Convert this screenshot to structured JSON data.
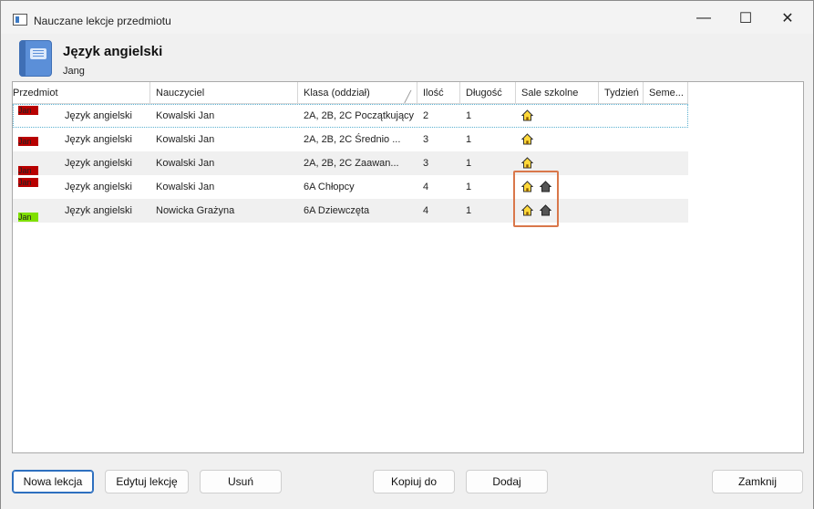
{
  "window": {
    "title": "Nauczane lekcje przedmiotu",
    "controls": {
      "minimize": "—",
      "maximize": "☐",
      "close": "✕"
    }
  },
  "header": {
    "title": "Język angielski",
    "subtitle": "Jang"
  },
  "grid": {
    "columns": [
      "Przedmiot",
      "Nauczyciel",
      "Klasa (oddział)",
      "Ilość",
      "Długość",
      "Sale szkolne",
      "Tydzień",
      "Seme..."
    ],
    "sort_indicator": "╱",
    "rows": [
      {
        "tag": "Jan",
        "tag_color": "#b80000",
        "subject": "Język angielski",
        "teacher": "Kowalski Jan",
        "class": "2A, 2B, 2C Początkujący",
        "count": "2",
        "length": "1",
        "rooms": [
          "house-yellow"
        ]
      },
      {
        "tag": "Jan",
        "tag_color": "#b80000",
        "subject": "Język angielski",
        "teacher": "Kowalski Jan",
        "class": "2A, 2B, 2C Średnio ...",
        "count": "3",
        "length": "1",
        "rooms": [
          "house-yellow"
        ]
      },
      {
        "tag": "Jan",
        "tag_color": "#b80000",
        "subject": "Język angielski",
        "teacher": "Kowalski Jan",
        "class": "2A, 2B, 2C Zaawan...",
        "count": "3",
        "length": "1",
        "rooms": [
          "house-yellow"
        ]
      },
      {
        "tag": "Jan",
        "tag_color": "#b80000",
        "subject": "Język angielski",
        "teacher": "Kowalski Jan",
        "class": "6A Chłopcy",
        "count": "4",
        "length": "1",
        "rooms": [
          "house-yellow",
          "house-dark"
        ]
      },
      {
        "tag": "Jan",
        "tag_color": "#7fe000",
        "subject": "Język angielski",
        "teacher": "Nowicka Grażyna",
        "class": "6A Dziewczęta",
        "count": "4",
        "length": "1",
        "rooms": [
          "house-yellow",
          "house-dark"
        ]
      }
    ]
  },
  "buttons": {
    "new_lesson": "Nowa lekcja",
    "edit_lesson": "Edytuj lekcję",
    "delete": "Usuń",
    "copy_to": "Kopiuj do",
    "add": "Dodaj",
    "close": "Zamknij"
  },
  "colors": {
    "highlight_border": "#d9774a",
    "primary_button_border": "#2d6fbf"
  }
}
